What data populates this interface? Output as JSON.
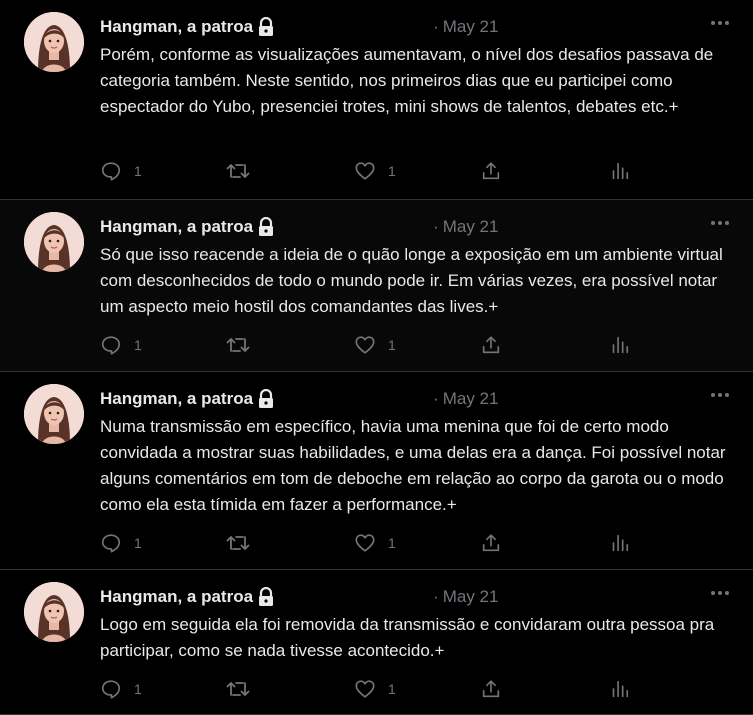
{
  "tweets": [
    {
      "author": "Hangman, a patroa",
      "separator": "·",
      "date": "May 21",
      "text": "Porém, conforme as visualizações aumentavam, o nível dos desafios passava de categoria também. Neste sentido, nos primeiros dias que eu participei como espectador do Yubo, presenciei trotes, mini shows de talentos, debates etc.+",
      "replies": "1",
      "likes": "1"
    },
    {
      "author": "Hangman, a patroa",
      "separator": "·",
      "date": "May 21",
      "text": "Só que isso reacende a ideia de o quão longe a exposição em um ambiente virtual com desconhecidos de todo o mundo pode ir. Em várias vezes, era possível notar um aspecto meio hostil dos comandantes das lives.+",
      "replies": "1",
      "likes": "1"
    },
    {
      "author": "Hangman, a patroa",
      "separator": "·",
      "date": "May 21",
      "text": "Numa transmissão em específico, havia uma menina que foi de certo modo convidada a mostrar suas habilidades, e uma delas era a dança. Foi possível notar alguns comentários em tom de deboche em relação ao corpo da garota ou o modo como ela esta tímida em fazer a performance.+",
      "replies": "1",
      "likes": "1"
    },
    {
      "author": "Hangman, a patroa",
      "separator": "·",
      "date": "May 21",
      "text": "Logo em seguida ela foi removida da transmissão e convidaram outra pessoa pra participar, como se nada tivesse acontecido.+",
      "replies": "1",
      "likes": "1"
    }
  ],
  "icons": {
    "reply": "reply-icon",
    "retweet": "retweet-icon",
    "like": "heart-icon",
    "share": "share-icon",
    "analytics": "analytics-icon",
    "more": "more-icon",
    "lock": "lock-icon"
  },
  "colors": {
    "background": "#000000",
    "text": "#e7e9ea",
    "muted": "#71767b",
    "divider": "#2f3336"
  }
}
